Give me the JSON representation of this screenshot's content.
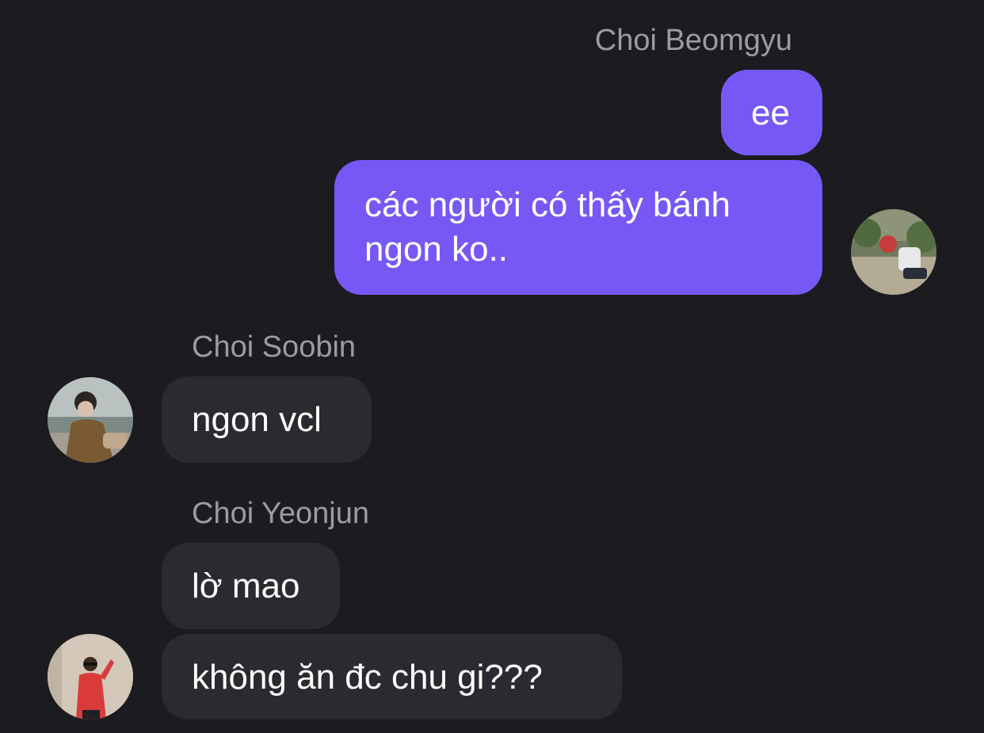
{
  "chat": {
    "groups": [
      {
        "sender": "Choi Beomgyu",
        "direction": "outgoing",
        "avatar_icon": "avatar-beomgyu",
        "messages": [
          "ee",
          "các người có thấy bánh\nngon ko.."
        ]
      },
      {
        "sender": "Choi Soobin",
        "direction": "incoming",
        "avatar_icon": "avatar-soobin",
        "messages": [
          "ngon vcl"
        ]
      },
      {
        "sender": "Choi Yeonjun",
        "direction": "incoming",
        "avatar_icon": "avatar-yeonjun",
        "messages": [
          "lờ mao",
          "không ăn đc chu gi???"
        ]
      }
    ]
  },
  "colors": {
    "background": "#1c1b1f",
    "outgoing_bubble": "#7659f5",
    "incoming_bubble": "#2b2a2f",
    "sender_name": "#9c9aa3",
    "message_text": "#ffffff"
  }
}
